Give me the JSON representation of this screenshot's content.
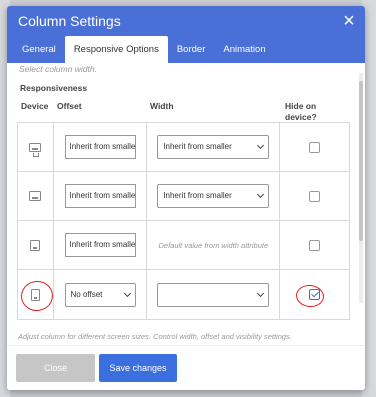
{
  "modal": {
    "title": "Column Settings",
    "close_label": "×",
    "tabs": [
      {
        "label": "General"
      },
      {
        "label": "Responsive Options"
      },
      {
        "label": "Border"
      },
      {
        "label": "Animation"
      }
    ],
    "select_hint": "Select column width.",
    "section_title": "Responsiveness",
    "columns": {
      "device": "Device",
      "offset": "Offset",
      "width": "Width",
      "hide": "Hide on device?"
    },
    "rows": [
      {
        "device_icon": "desktop-icon",
        "offset": "Inherit from smaller",
        "width": "Inherit from smaller",
        "hide_checked": false
      },
      {
        "device_icon": "laptop-icon",
        "offset": "Inherit from smaller",
        "width": "Inherit from smaller",
        "hide_checked": false
      },
      {
        "device_icon": "tablet-icon",
        "offset": "Inherit from smaller",
        "width_note": "Default value from width attribute",
        "hide_checked": false
      },
      {
        "device_icon": "phone-icon",
        "offset": "No offset",
        "width": "",
        "hide_checked": true
      }
    ],
    "footer_hint": "Adjust column for different screen sizes. Control width, offset and visibility settings.",
    "buttons": {
      "close": "Close",
      "save": "Save changes"
    }
  },
  "colors": {
    "header": "#4a70d8",
    "primary_button": "#3b6fe0",
    "annotation": "#e02020"
  }
}
